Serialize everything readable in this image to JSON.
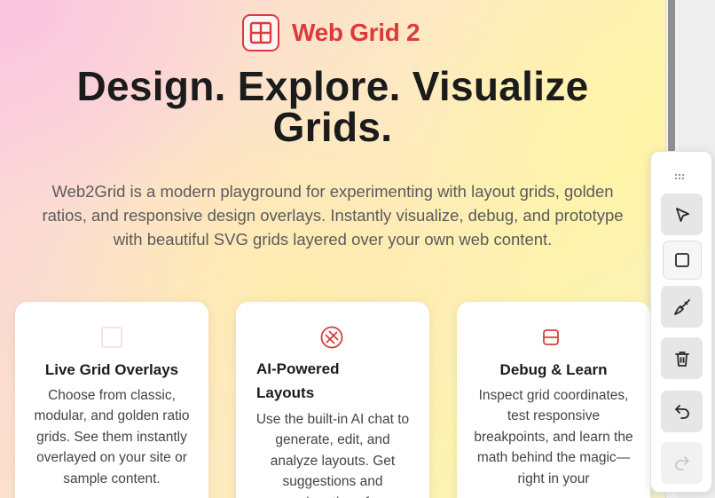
{
  "brand": {
    "name": "Web Grid 2",
    "icon": "grid-logo-icon",
    "accent_color": "#dc3b3b"
  },
  "hero": {
    "title": "Design. Explore. Visualize Grids.",
    "description": "Web2Grid is a modern playground for experimenting with layout grids, golden ratios, and responsive design overlays. Instantly visualize, debug, and prototype with beautiful SVG grids layered over your own web content."
  },
  "features": [
    {
      "icon": "grid-icon",
      "title": "Live Grid Overlays",
      "text": "Choose from classic, modular, and golden ratio grids. See them instantly overlayed on your site or sample content."
    },
    {
      "icon": "circle-cross-icon",
      "title": "AI-Powered Layouts",
      "text": "Use the built-in AI chat to generate, edit, and analyze layouts. Get suggestions and explanations for"
    },
    {
      "icon": "split-square-icon",
      "title": "Debug & Learn",
      "text": "Inspect grid coordinates, test responsive breakpoints, and learn the math behind the magic—right in your"
    }
  ],
  "toolbar": {
    "grip_icon": "drag-grip-icon",
    "tools": [
      {
        "name": "select",
        "icon": "cursor-icon",
        "enabled": true
      },
      {
        "name": "rectangle",
        "icon": "square-icon",
        "enabled": true
      },
      {
        "name": "brush",
        "icon": "brush-icon",
        "enabled": true
      },
      {
        "name": "delete",
        "icon": "trash-icon",
        "enabled": true
      },
      {
        "name": "undo",
        "icon": "undo-icon",
        "enabled": true
      },
      {
        "name": "redo",
        "icon": "redo-icon",
        "enabled": false
      }
    ]
  }
}
